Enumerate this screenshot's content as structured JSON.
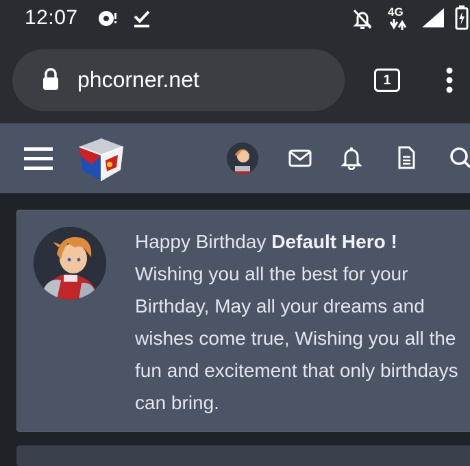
{
  "status_bar": {
    "time": "12:07",
    "network": "4G",
    "icons": [
      "sync-icon",
      "download-done-icon",
      "notifications-off-icon",
      "network-4g-icon",
      "signal-icon",
      "battery-charging-icon"
    ]
  },
  "browser": {
    "url": "phcorner.net",
    "tab_count": "1",
    "icons": [
      "lock-icon",
      "tabs-icon",
      "more-vert-icon"
    ]
  },
  "site_header": {
    "icons": [
      "hamburger-menu-icon",
      "site-logo",
      "user-avatar",
      "mail-icon",
      "bell-icon",
      "document-icon",
      "search-icon"
    ]
  },
  "birthday_card": {
    "greeting": "Happy Birthday ",
    "name": "Default Hero !",
    "message": "Wishing you all the best for your Birthday, May all your dreams and wishes come true, Wishing you all the fun and excitement that only birthdays can bring."
  },
  "colors": {
    "status_bg": "#292c30",
    "urlbar_bg": "#3b3e43",
    "header_bg": "#4a5465",
    "card_bg": "#4c5566",
    "page_bg": "#1f2226"
  }
}
